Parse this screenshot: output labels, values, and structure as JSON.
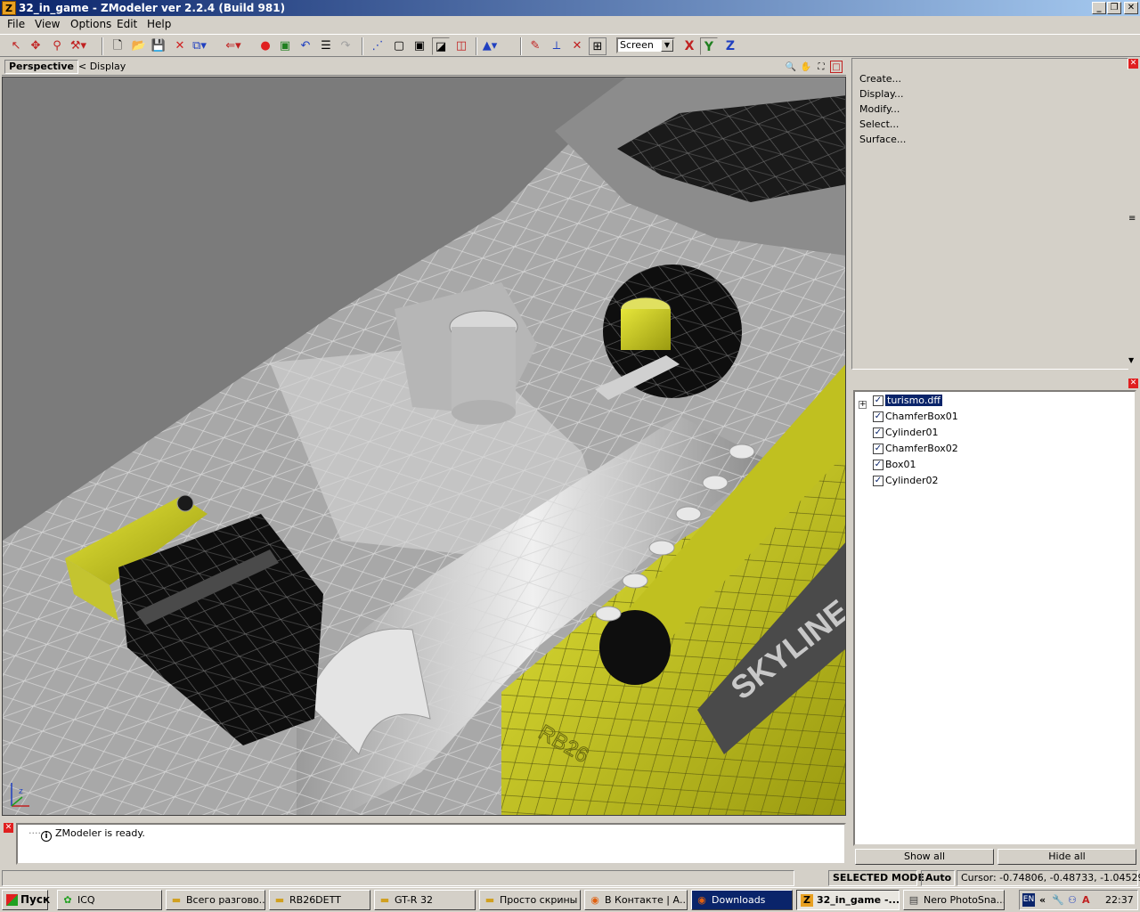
{
  "window": {
    "title": "32_in_game - ZModeler ver 2.2.4 (Build 981)",
    "app_icon": "Z"
  },
  "menu": [
    "File",
    "View",
    "Options",
    "Edit",
    "Help"
  ],
  "toolbar": {
    "view_combo": "Screen",
    "axis_x": "X",
    "axis_y": "Y",
    "axis_z": "Z"
  },
  "viewport": {
    "tab": "Perspective",
    "display_label": "<  Display",
    "hood_text": "SKYLINE GT-R",
    "cover_text": "RB26",
    "gizmo_z": "z",
    "colors": {
      "background": "#7b7b7b",
      "mesh": "#c8c8c8",
      "yellow": "#c8c820",
      "black": "#101010"
    }
  },
  "command_panel": {
    "items": [
      "Create...",
      "Display...",
      "Modify...",
      "Select...",
      "Surface..."
    ]
  },
  "objects_panel": {
    "items": [
      {
        "label": "turismo.dff",
        "checked": true,
        "selected": true
      },
      {
        "label": "ChamferBox01",
        "checked": true
      },
      {
        "label": "Cylinder01",
        "checked": true
      },
      {
        "label": "ChamferBox02",
        "checked": true
      },
      {
        "label": "Box01",
        "checked": true
      },
      {
        "label": "Cylinder02",
        "checked": true
      }
    ],
    "show_all": "Show all",
    "hide_all": "Hide all"
  },
  "log": {
    "message": "ZModeler is ready."
  },
  "statusbar": {
    "mode": "SELECTED MODE",
    "auto": "Auto",
    "cursor": "Cursor: -0.74806, -0.48733, -1.04529"
  },
  "taskbar": {
    "start": "Пуск",
    "tasks": [
      {
        "label": "ICQ",
        "icon": "flower-icon"
      },
      {
        "label": "Всего разгово...",
        "icon": "folder-icon"
      },
      {
        "label": "RB26DETT",
        "icon": "folder-icon"
      },
      {
        "label": "GT-R 32",
        "icon": "folder-icon"
      },
      {
        "label": "Просто скрины",
        "icon": "folder-icon"
      },
      {
        "label": "В Контакте | А...",
        "icon": "firefox-icon"
      },
      {
        "label": "Downloads",
        "icon": "firefox-icon"
      },
      {
        "label": "32_in_game -...",
        "icon": "zmodeler-icon"
      },
      {
        "label": "Nero PhotoSna...",
        "icon": "nero-icon"
      }
    ],
    "lang": "EN",
    "clock": "22:37"
  }
}
